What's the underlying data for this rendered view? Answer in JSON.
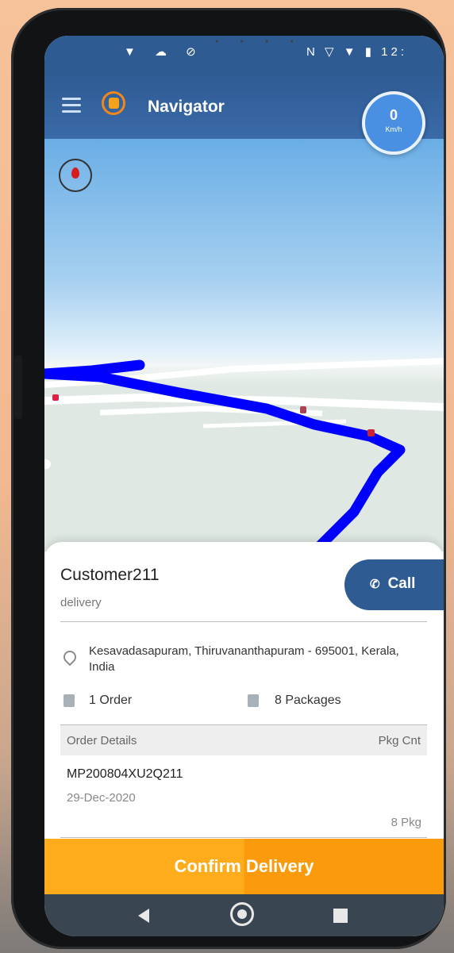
{
  "status_bar": {
    "left_icons": "▼ ☁ ⊘",
    "right_icons": "N ▽ ▼ ▮ 12:"
  },
  "app_bar": {
    "title": "Navigator",
    "menu_icon": "hamburger-menu-icon",
    "logo_icon": "navigator-logo-icon",
    "speed_value": "0",
    "speed_unit": "Km/h"
  },
  "map": {
    "compass_icon": "compass-icon",
    "route_color": "#0000ff"
  },
  "customer": {
    "name": "Customer211",
    "type": "delivery",
    "call_label": "Call",
    "address": "Kesavadasapuram, Thiruvananthapuram - 695001, Kerala, India",
    "order_count": "1 Order",
    "package_count": "8 Packages"
  },
  "details": {
    "header_left": "Order Details",
    "header_right": "Pkg Cnt",
    "orders": [
      {
        "id": "MP200804XU2Q211",
        "date": "29-Dec-2020",
        "pkg": "8 Pkg"
      }
    ]
  },
  "confirm_label": "Confirm Delivery",
  "colors": {
    "primary": "#2f5b93",
    "accent": "#ffac1c"
  }
}
